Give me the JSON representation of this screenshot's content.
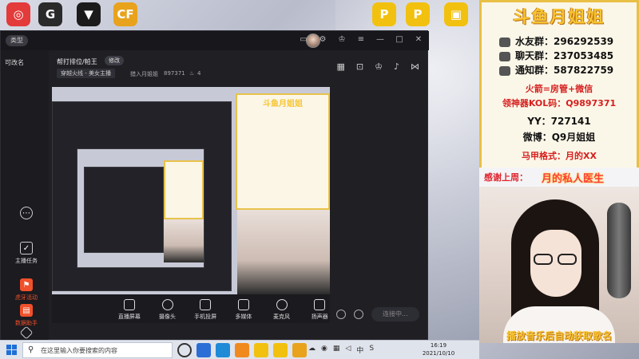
{
  "desktop": {
    "shortcuts": [
      {
        "icon": "netease-cloud-music-icon",
        "color": "#e33a3a",
        "glyph": "◎"
      },
      {
        "icon": "g-app-icon",
        "color": "#2a2a2a",
        "glyph": "G"
      },
      {
        "icon": "shield-game-icon",
        "color": "#1b1b1b",
        "glyph": "▼"
      },
      {
        "icon": "crossfire-icon",
        "color": "#e8a21c",
        "glyph": "CF"
      },
      {
        "icon": "p-app-icon-1",
        "color": "#f2c10f",
        "glyph": "P"
      },
      {
        "icon": "p-app-icon-2",
        "color": "#f2c10f",
        "glyph": "P"
      },
      {
        "icon": "folder-app-icon",
        "color": "#f2c10f",
        "glyph": "▣"
      }
    ]
  },
  "app": {
    "side_pill": "类型",
    "sidebar": {
      "top_label": "可改名",
      "items": [
        {
          "label": "主播任务"
        },
        {
          "label": "虎牙活动"
        },
        {
          "label": "数据助手"
        }
      ]
    },
    "header": {
      "title": "帮打排位/帕王",
      "edit_label": "修改",
      "category": "穿越火线 - 美女主播",
      "anchor_name": "猎入月姐姐",
      "room_id": "897371",
      "popularity": "4"
    },
    "toolbar": [
      {
        "label": "直播屏幕"
      },
      {
        "label": "摄像头"
      },
      {
        "label": "手机投屏"
      },
      {
        "label": "多媒体"
      },
      {
        "label": "麦克风"
      },
      {
        "label": "扬声器"
      }
    ],
    "start_live_label": "连接中..."
  },
  "panel": {
    "title": "斗鱼月姐姐",
    "groups": [
      {
        "label": "水友群：296292539"
      },
      {
        "label": "聊天群：237053485"
      },
      {
        "label": "通知群：587822759"
      }
    ],
    "promo": "火箭=房管+微信",
    "kol_code": "领神器KOL码：Q9897371",
    "yy": "YY：727141",
    "weibo": "微博：Q9月姐姐",
    "vest_format": "马甲格式：月的XX"
  },
  "thanks": {
    "prefix": "感谢上周：",
    "name": "月的私人医生"
  },
  "cam": {
    "ticker": "播放音乐后自动获取歌名"
  },
  "taskbar": {
    "search_placeholder": "在这里输入你要搜索的内容",
    "tray_lang": "中",
    "time": "16:19",
    "date": "2021/10/10"
  }
}
